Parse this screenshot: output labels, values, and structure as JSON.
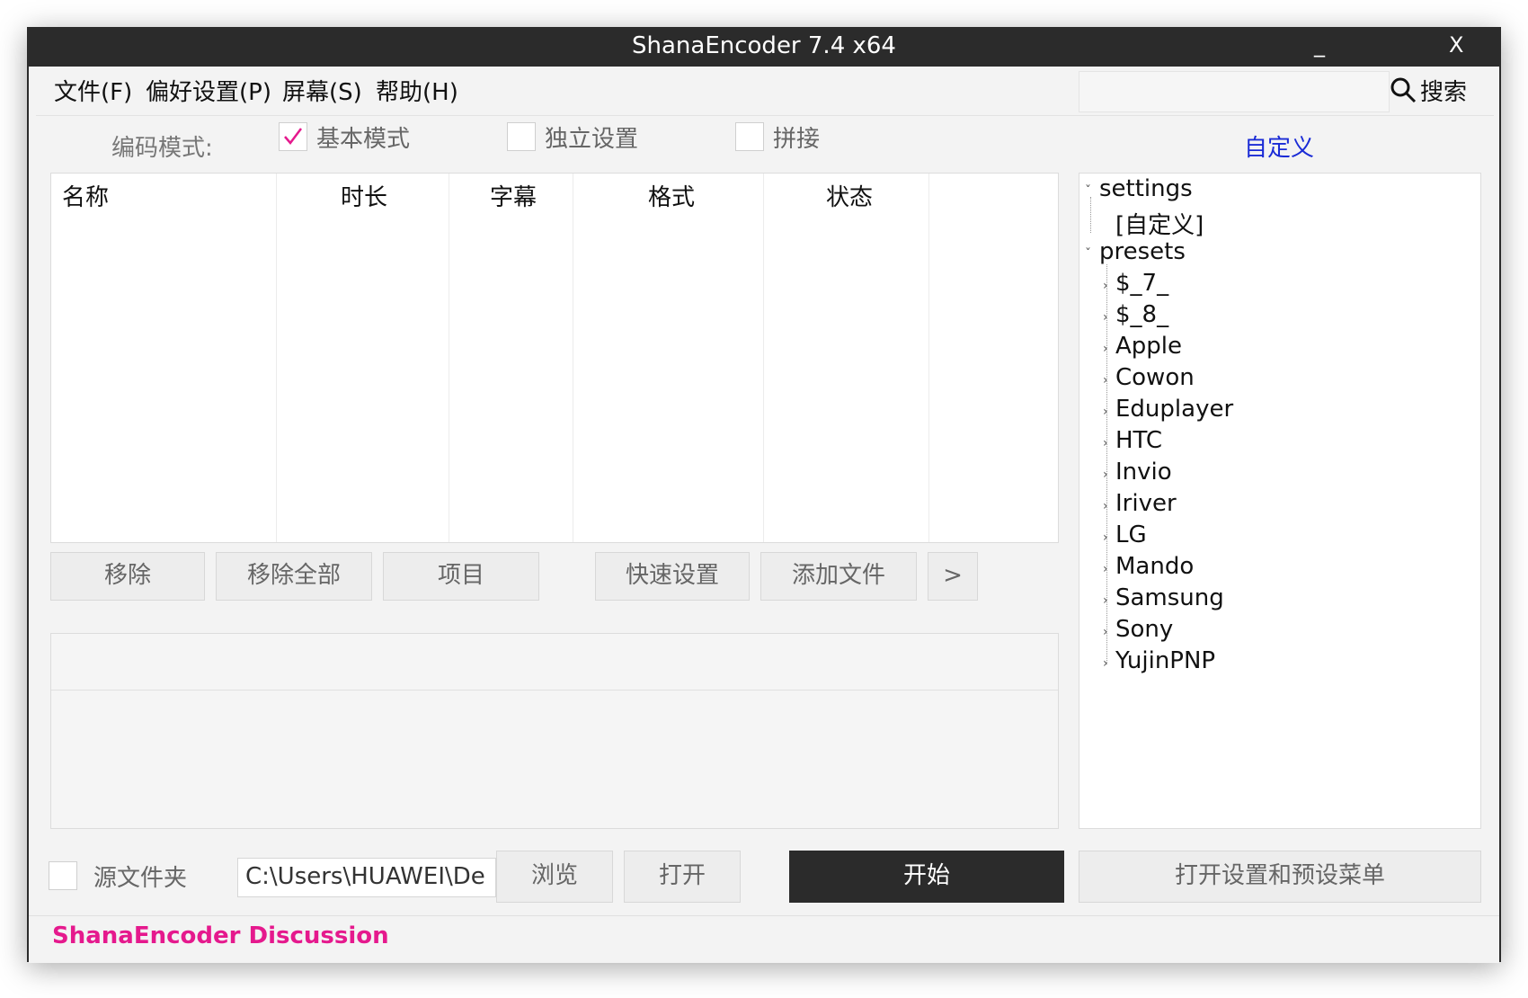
{
  "window": {
    "title": "ShanaEncoder 7.4 x64",
    "minimize_label": "_",
    "close_label": "X"
  },
  "menu": {
    "items": [
      "文件(F)",
      "偏好设置(P)",
      "屏幕(S)",
      "帮助(H)"
    ],
    "search_label": "搜索",
    "search_value": ""
  },
  "mode": {
    "label": "编码模式:",
    "options": [
      {
        "label": "基本模式",
        "checked": true
      },
      {
        "label": "独立设置",
        "checked": false
      },
      {
        "label": "拼接",
        "checked": false
      }
    ],
    "custom_link": "自定义"
  },
  "file_list": {
    "columns": [
      "名称",
      "时长",
      "字幕",
      "格式",
      "状态"
    ],
    "rows": []
  },
  "action_buttons": {
    "remove": "移除",
    "remove_all": "移除全部",
    "item": "项目",
    "quick_settings": "快速设置",
    "add_file": "添加文件",
    "more": ">"
  },
  "tree": {
    "settings_label": "settings",
    "settings_children": [
      "[自定义]"
    ],
    "presets_label": "presets",
    "presets_children": [
      "$_7_",
      "$_8_",
      "Apple",
      "Cowon",
      "Eduplayer",
      "HTC",
      "Invio",
      "Iriver",
      "LG",
      "Mando",
      "Samsung",
      "Sony",
      "YujinPNP"
    ]
  },
  "output": {
    "source_folder_label": "源文件夹",
    "source_folder_checked": false,
    "path_value": "C:\\Users\\HUAWEI\\De",
    "browse": "浏览",
    "open": "打开",
    "start": "开始",
    "settings_menu": "打开设置和预设菜单"
  },
  "status": {
    "discussion_link": "ShanaEncoder Discussion"
  },
  "colors": {
    "titlebar": "#2b2b2b",
    "accent_pink": "#e5198d",
    "link_blue": "#1a2bd6",
    "checkmark": "#e5198d"
  }
}
